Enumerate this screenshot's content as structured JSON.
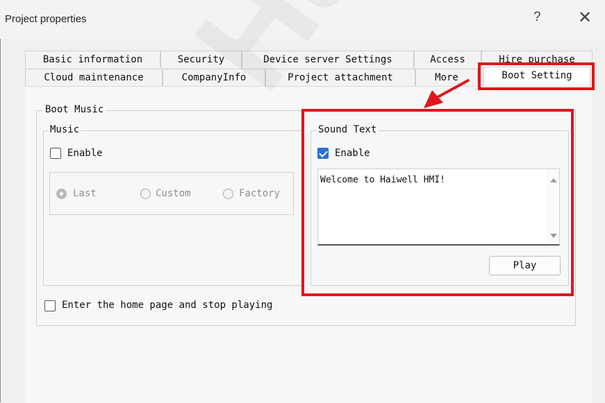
{
  "window": {
    "title": "Project properties",
    "help_glyph": "?",
    "close_glyph": "✕"
  },
  "tabs_row1": [
    "Basic information",
    "Security",
    "Device server Settings",
    "Access",
    "Hire purchase"
  ],
  "tabs_row2": [
    "Cloud maintenance",
    "CompanyInfo",
    "Project attachment",
    "More",
    "Boot Setting"
  ],
  "active_tab": "Boot Setting",
  "boot_music": {
    "title": "Boot Music",
    "music": {
      "title": "Music",
      "enable_label": "Enable",
      "enable_checked": false,
      "options": [
        "Last",
        "Custom",
        "Factory"
      ],
      "selected_option": "Last"
    },
    "sound_text": {
      "title": "Sound Text",
      "enable_label": "Enable",
      "enable_checked": true,
      "text_value": "Welcome to Haiwell HMI!",
      "play_label": "Play"
    },
    "stop_playing_label": "Enter the home page and stop playing",
    "stop_playing_checked": false
  },
  "watermark": "Haiwell",
  "highlight_color": "#e0161c"
}
